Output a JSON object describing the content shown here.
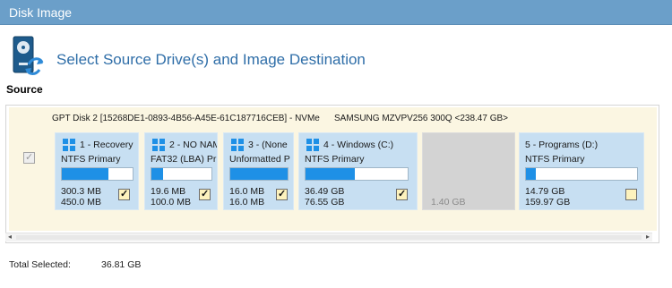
{
  "window": {
    "title": "Disk Image"
  },
  "header": {
    "title": "Select Source Drive(s) and Image Destination",
    "icon": "disk-image-icon"
  },
  "source": {
    "label": "Source"
  },
  "disk": {
    "name": "GPT Disk 2 [15268DE1-0893-4B56-A45E-61C187716CEB] - NVMe",
    "model": "SAMSUNG MZVPV256 300Q  <238.47 GB>",
    "selected": true
  },
  "partitions": [
    {
      "name": "1 - Recovery (",
      "fs": "NTFS Primary",
      "used": "300.3 MB",
      "total": "450.0 MB",
      "usage": 0.66,
      "checked": true
    },
    {
      "name": "2 - NO NAM",
      "fs": "FAT32 (LBA) Pr",
      "used": "19.6 MB",
      "total": "100.0 MB",
      "usage": 0.2,
      "checked": true
    },
    {
      "name": "3 -  (None",
      "fs": "Unformatted P",
      "used": "16.0 MB",
      "total": "16.0 MB",
      "usage": 1.0,
      "checked": true
    },
    {
      "name": "4 - Windows (C:)",
      "fs": "NTFS Primary",
      "used": "36.49 GB",
      "total": "76.55 GB",
      "usage": 0.48,
      "checked": true
    },
    {
      "size": "1.40 GB",
      "unallocated": true
    },
    {
      "name": "5 - Programs (D:)",
      "fs": "NTFS Primary",
      "used": "14.79 GB",
      "total": "159.97 GB",
      "usage": 0.09,
      "checked": false
    }
  ],
  "footer": {
    "total_label": "Total Selected:",
    "total_value": "36.81 GB"
  },
  "colors": {
    "titlebar": "#6b9fc9",
    "accent": "#2f6ea8",
    "partition_bg": "#c7dff2",
    "usage_fill": "#1e90e6",
    "panel_bg": "#fbf6e2"
  }
}
